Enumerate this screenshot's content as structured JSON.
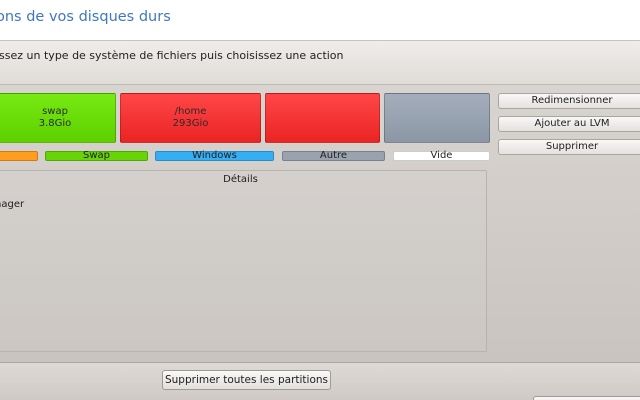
{
  "header": {
    "title": "ons de vos disques durs"
  },
  "instruction": "issez un type de système de fichiers puis choisissez une action",
  "partitions": [
    {
      "name": "swap",
      "size": "3.8Gio",
      "color": "#66d406"
    },
    {
      "name": "/home",
      "size": "293Gio",
      "color": "#f23030"
    },
    {
      "name": "",
      "size": "",
      "color": "#f23030"
    },
    {
      "name": "",
      "size": "",
      "color": "#97a1ae"
    }
  ],
  "legend": [
    {
      "label": "",
      "color": "#ff9d1e"
    },
    {
      "label": "Swap",
      "color": "#66d406"
    },
    {
      "label": "Windows",
      "color": "#36aef4"
    },
    {
      "label": "Autre",
      "color": "#9aa2ae"
    },
    {
      "label": "Vide",
      "color": "#ffffff"
    }
  ],
  "details": {
    "title": "Détails",
    "text": "nager"
  },
  "actions": {
    "resize": "Redimensionner",
    "add_lvm": "Ajouter au LVM",
    "delete": "Supprimer"
  },
  "footer": {
    "delete_all": "Supprimer toutes les partitions"
  }
}
